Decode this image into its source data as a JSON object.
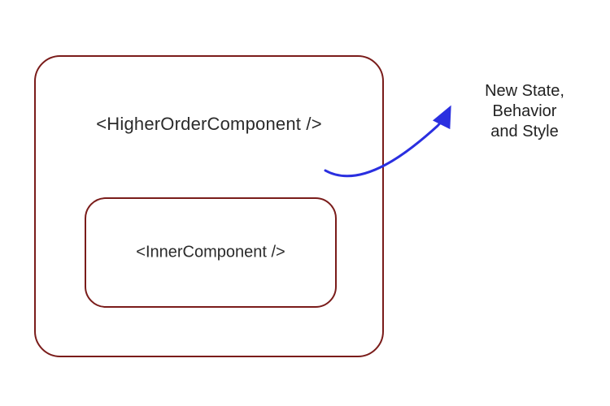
{
  "diagram": {
    "outer_component_label": "<HigherOrderComponent />",
    "inner_component_label": "<InnerComponent />",
    "annotation_line1": "New State,",
    "annotation_line2": "Behavior",
    "annotation_line3": "and Style",
    "colors": {
      "box_border": "#7a1c1a",
      "arrow": "#2a2fe0",
      "text": "#2b2b2b"
    }
  }
}
